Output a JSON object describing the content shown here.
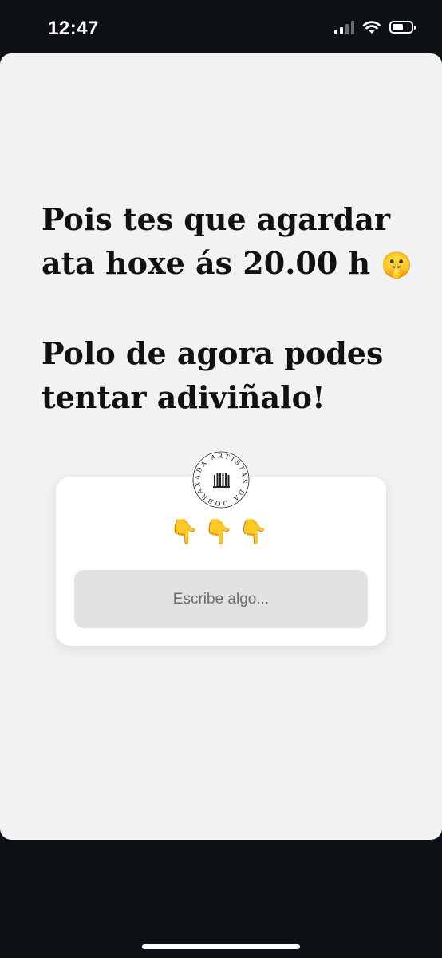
{
  "status_bar": {
    "time": "12:47",
    "icons": [
      "signal-icon",
      "wifi-icon",
      "battery-icon"
    ],
    "battery_level": 0.6
  },
  "story": {
    "background": "#f2f2f2",
    "headline_line1": "Pois tes que agardar",
    "headline_line2": "ata hoxe ás 20.00 h",
    "headline_emoji": "🤫",
    "headline_line3": "Polo de agora podes",
    "headline_line4": "tentar adiviñalo!"
  },
  "question_sticker": {
    "logo_text": "ADA ARTISTAS DA DOBRAXE",
    "pointing_emojis": "👇👇👇",
    "input_placeholder": "Escribe algo..."
  },
  "colors": {
    "frame": "#0d1014",
    "text": "#111111",
    "input_bg": "#e2e2e2"
  }
}
